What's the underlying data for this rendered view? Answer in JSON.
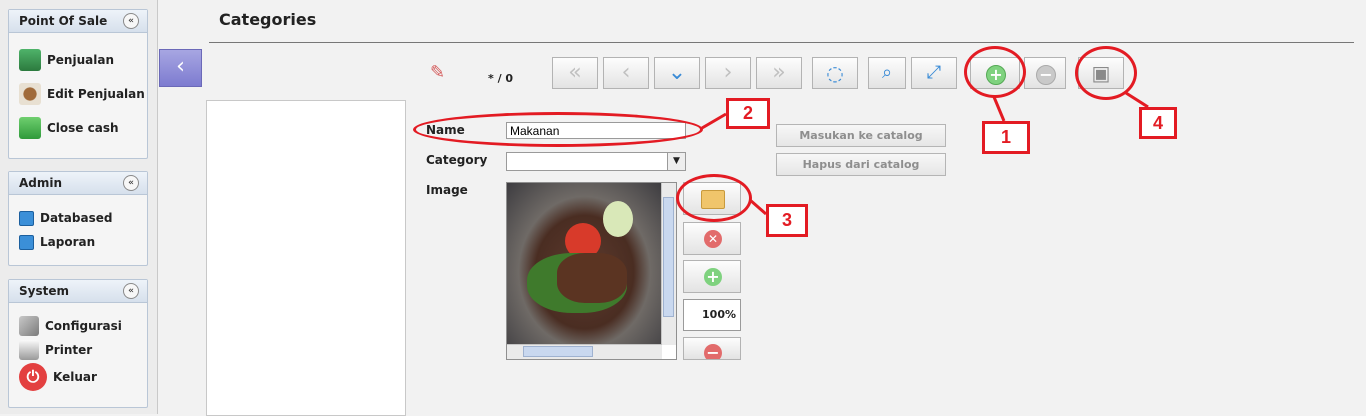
{
  "sidebar": {
    "pos": {
      "title": "Point Of Sale",
      "items": [
        "Penjualan",
        "Edit Penjualan",
        "Close cash"
      ]
    },
    "admin": {
      "title": "Admin",
      "items": [
        "Databased",
        "Laporan"
      ]
    },
    "system": {
      "title": "System",
      "items": [
        "Configurasi",
        "Printer",
        "Keluar"
      ]
    },
    "collapse_glyph": "«",
    "back_glyph": "‹"
  },
  "main": {
    "title": "Categories",
    "record_indicator": "* / 0",
    "toolbar": {
      "first": "«",
      "prev": "‹",
      "down": "⌄",
      "next": "›",
      "last": "»",
      "reload": "◌",
      "search": "⌕",
      "expand": "⤢",
      "add": "+",
      "remove": "−",
      "save": "▣"
    },
    "form": {
      "name_label": "Name",
      "name_value": "Makanan",
      "category_label": "Category",
      "category_value": "",
      "image_label": "Image",
      "add_to_catalog": "Masukan ke catalog",
      "remove_from_catalog": "Hapus dari catalog",
      "zoom": "100%"
    }
  },
  "annotations": [
    "1",
    "2",
    "3",
    "4"
  ],
  "colors": {
    "annotation": "#e31b23",
    "accent_blue": "#3a8bd6",
    "nav_purple": "#7d7bd0"
  }
}
